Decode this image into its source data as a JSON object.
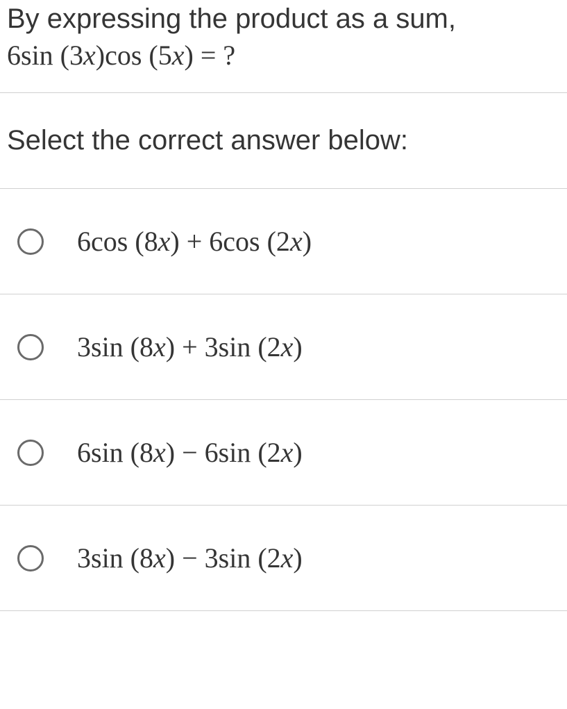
{
  "question": {
    "line1": "By expressing the product as a sum,",
    "math_html": "6sin (3<span class='math-var'>x</span>)cos (5<span class='math-var'>x</span>) = ?"
  },
  "prompt": "Select the correct answer below:",
  "options": [
    {
      "html": "6cos (8<span class='math-var'>x</span>) + 6cos (2<span class='math-var'>x</span>)",
      "name": "option-1"
    },
    {
      "html": "3sin (8<span class='math-var'>x</span>) + 3sin (2<span class='math-var'>x</span>)",
      "name": "option-2"
    },
    {
      "html": "6sin (8<span class='math-var'>x</span>) − 6sin (2<span class='math-var'>x</span>)",
      "name": "option-3"
    },
    {
      "html": "3sin (8<span class='math-var'>x</span>) − 3sin (2<span class='math-var'>x</span>)",
      "name": "option-4"
    }
  ]
}
